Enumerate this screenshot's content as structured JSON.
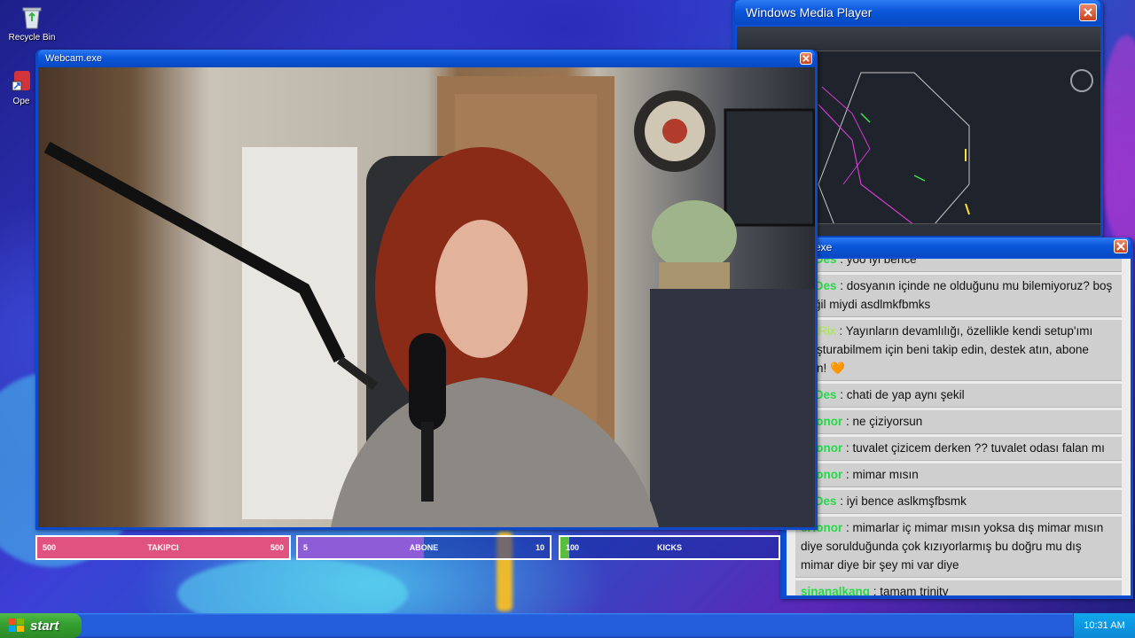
{
  "desktop": {
    "recycle_bin_label": "Recycle Bin",
    "open_label": "Ope"
  },
  "webcam_window": {
    "title": "Webcam.exe"
  },
  "media_player_window": {
    "title": "Windows Media Player"
  },
  "chat_window": {
    "title": "exe",
    "messages": [
      {
        "user": "koDes",
        "text": " : yoo iyi bence",
        "user_color": "green"
      },
      {
        "user": "koDes",
        "text": " : dosyanın içinde ne olduğunu mu bilemiyoruz? boş değil miydi asdlmkfbmks",
        "user_color": "green"
      },
      {
        "user": "BotRix",
        "text": " : Yayınların devamlılığı, özellikle kendi setup'ımı oluşturabilmem için beni takip edin, destek atın, abone olun! 🧡",
        "user_color": "yellow"
      },
      {
        "user": "koDes",
        "text": " : chati de yap aynı şekil",
        "user_color": "green"
      },
      {
        "user": "cHonor",
        "text": " : ne çiziyorsun",
        "user_color": "green"
      },
      {
        "user": "cHonor",
        "text": " : tuvalet çizicem derken ?? tuvalet odası falan mı",
        "user_color": "green"
      },
      {
        "user": "cHonor",
        "text": " : mimar mısın",
        "user_color": "green"
      },
      {
        "user": "koDes",
        "text": " : iyi bence aslkmşfbsmk",
        "user_color": "green"
      },
      {
        "user": "cHonor",
        "text": " : mimarlar iç mimar mısın yoksa dış mimar mısın diye sorulduğunda çok kızıyorlarmış bu doğru mu dış mimar diye bir şey mi var diye",
        "user_color": "green"
      },
      {
        "user": "sinanalkang",
        "text": " : tamam trinity",
        "user_color": "green"
      }
    ]
  },
  "goals": [
    {
      "left": "500",
      "label": "TAKIPCI",
      "right": "500",
      "fill": 1.0,
      "color": "#e0527f"
    },
    {
      "left": "5",
      "label": "ABONE",
      "right": "10",
      "fill": 0.5,
      "color": "#8d5cd6"
    },
    {
      "left": "100",
      "label": "KICKS",
      "right": "",
      "fill": 0.04,
      "color": "#5bbd3e"
    }
  ],
  "taskbar": {
    "start_label": "start",
    "clock": "10:31 AM"
  },
  "colors": {
    "title_bar": "#0a56d9",
    "taskbar": "#245edb",
    "start_green": "#37a132"
  }
}
